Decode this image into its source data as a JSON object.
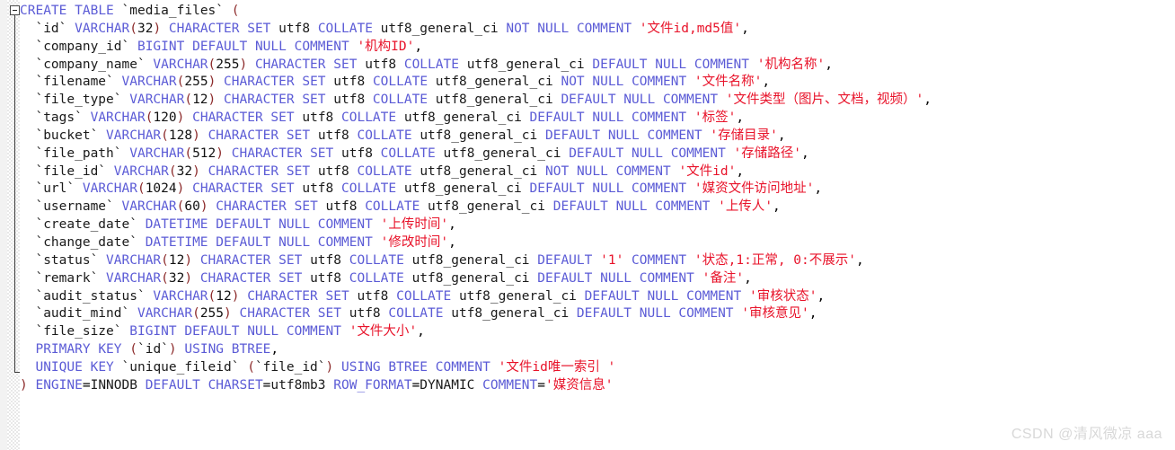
{
  "editor": {
    "language": "sql",
    "fold_widget": "minus-fold-icon",
    "colors": {
      "background": "#ffffff",
      "keyword": "#5b5bd6",
      "type": "#5b5bd6",
      "identifier": "#1a1a1a",
      "string": "#e8132a",
      "paren": "#8c2a2a",
      "gutter": "#f2f2f2",
      "fold_line": "#3a3a3a",
      "watermark": "#d8d8d8"
    }
  },
  "watermark": {
    "text": "CSDN @清风微凉 aaa"
  },
  "sql": {
    "table_name": "media_files",
    "statement": "CREATE TABLE",
    "engine_clause": "ENGINE=INNODB DEFAULT CHARSET=utf8mb3 ROW_FORMAT=DYNAMIC COMMENT='媒资信息'",
    "table_comment": "媒资信息",
    "charset": "utf8mb3",
    "engine": "INNODB",
    "row_format": "DYNAMIC",
    "lines": [
      "CREATE TABLE `media_files` (",
      "  `id` VARCHAR(32) CHARACTER SET utf8 COLLATE utf8_general_ci NOT NULL COMMENT '文件id,md5值',",
      "  `company_id` BIGINT DEFAULT NULL COMMENT '机构ID',",
      "  `company_name` VARCHAR(255) CHARACTER SET utf8 COLLATE utf8_general_ci DEFAULT NULL COMMENT '机构名称',",
      "  `filename` VARCHAR(255) CHARACTER SET utf8 COLLATE utf8_general_ci NOT NULL COMMENT '文件名称',",
      "  `file_type` VARCHAR(12) CHARACTER SET utf8 COLLATE utf8_general_ci DEFAULT NULL COMMENT '文件类型（图片、文档，视频）',",
      "  `tags` VARCHAR(120) CHARACTER SET utf8 COLLATE utf8_general_ci DEFAULT NULL COMMENT '标签',",
      "  `bucket` VARCHAR(128) CHARACTER SET utf8 COLLATE utf8_general_ci DEFAULT NULL COMMENT '存储目录',",
      "  `file_path` VARCHAR(512) CHARACTER SET utf8 COLLATE utf8_general_ci DEFAULT NULL COMMENT '存储路径',",
      "  `file_id` VARCHAR(32) CHARACTER SET utf8 COLLATE utf8_general_ci NOT NULL COMMENT '文件id',",
      "  `url` VARCHAR(1024) CHARACTER SET utf8 COLLATE utf8_general_ci DEFAULT NULL COMMENT '媒资文件访问地址',",
      "  `username` VARCHAR(60) CHARACTER SET utf8 COLLATE utf8_general_ci DEFAULT NULL COMMENT '上传人',",
      "  `create_date` DATETIME DEFAULT NULL COMMENT '上传时间',",
      "  `change_date` DATETIME DEFAULT NULL COMMENT '修改时间',",
      "  `status` VARCHAR(12) CHARACTER SET utf8 COLLATE utf8_general_ci DEFAULT '1' COMMENT '状态,1:正常, 0:不展示',",
      "  `remark` VARCHAR(32) CHARACTER SET utf8 COLLATE utf8_general_ci DEFAULT NULL COMMENT '备注',",
      "  `audit_status` VARCHAR(12) CHARACTER SET utf8 COLLATE utf8_general_ci DEFAULT NULL COMMENT '审核状态',",
      "  `audit_mind` VARCHAR(255) CHARACTER SET utf8 COLLATE utf8_general_ci DEFAULT NULL COMMENT '审核意见',",
      "  `file_size` BIGINT DEFAULT NULL COMMENT '文件大小',",
      "  PRIMARY KEY (`id`) USING BTREE,",
      "  UNIQUE KEY `unique_fileid` (`file_id`) USING BTREE COMMENT '文件id唯一索引 '",
      ") ENGINE=INNODB DEFAULT CHARSET=utf8mb3 ROW_FORMAT=DYNAMIC COMMENT='媒资信息'"
    ],
    "columns": [
      {
        "name": "id",
        "type": "VARCHAR(32)",
        "charset": "utf8",
        "collate": "utf8_general_ci",
        "nullability": "NOT NULL",
        "default": null,
        "comment": "文件id,md5值"
      },
      {
        "name": "company_id",
        "type": "BIGINT",
        "charset": null,
        "collate": null,
        "nullability": "DEFAULT NULL",
        "default": "NULL",
        "comment": "机构ID"
      },
      {
        "name": "company_name",
        "type": "VARCHAR(255)",
        "charset": "utf8",
        "collate": "utf8_general_ci",
        "nullability": "DEFAULT NULL",
        "default": "NULL",
        "comment": "机构名称"
      },
      {
        "name": "filename",
        "type": "VARCHAR(255)",
        "charset": "utf8",
        "collate": "utf8_general_ci",
        "nullability": "NOT NULL",
        "default": null,
        "comment": "文件名称"
      },
      {
        "name": "file_type",
        "type": "VARCHAR(12)",
        "charset": "utf8",
        "collate": "utf8_general_ci",
        "nullability": "DEFAULT NULL",
        "default": "NULL",
        "comment": "文件类型（图片、文档，视频）"
      },
      {
        "name": "tags",
        "type": "VARCHAR(120)",
        "charset": "utf8",
        "collate": "utf8_general_ci",
        "nullability": "DEFAULT NULL",
        "default": "NULL",
        "comment": "标签"
      },
      {
        "name": "bucket",
        "type": "VARCHAR(128)",
        "charset": "utf8",
        "collate": "utf8_general_ci",
        "nullability": "DEFAULT NULL",
        "default": "NULL",
        "comment": "存储目录"
      },
      {
        "name": "file_path",
        "type": "VARCHAR(512)",
        "charset": "utf8",
        "collate": "utf8_general_ci",
        "nullability": "DEFAULT NULL",
        "default": "NULL",
        "comment": "存储路径"
      },
      {
        "name": "file_id",
        "type": "VARCHAR(32)",
        "charset": "utf8",
        "collate": "utf8_general_ci",
        "nullability": "NOT NULL",
        "default": null,
        "comment": "文件id"
      },
      {
        "name": "url",
        "type": "VARCHAR(1024)",
        "charset": "utf8",
        "collate": "utf8_general_ci",
        "nullability": "DEFAULT NULL",
        "default": "NULL",
        "comment": "媒资文件访问地址"
      },
      {
        "name": "username",
        "type": "VARCHAR(60)",
        "charset": "utf8",
        "collate": "utf8_general_ci",
        "nullability": "DEFAULT NULL",
        "default": "NULL",
        "comment": "上传人"
      },
      {
        "name": "create_date",
        "type": "DATETIME",
        "charset": null,
        "collate": null,
        "nullability": "DEFAULT NULL",
        "default": "NULL",
        "comment": "上传时间"
      },
      {
        "name": "change_date",
        "type": "DATETIME",
        "charset": null,
        "collate": null,
        "nullability": "DEFAULT NULL",
        "default": "NULL",
        "comment": "修改时间"
      },
      {
        "name": "status",
        "type": "VARCHAR(12)",
        "charset": "utf8",
        "collate": "utf8_general_ci",
        "nullability": "DEFAULT",
        "default": "'1'",
        "comment": "状态,1:正常, 0:不展示"
      },
      {
        "name": "remark",
        "type": "VARCHAR(32)",
        "charset": "utf8",
        "collate": "utf8_general_ci",
        "nullability": "DEFAULT NULL",
        "default": "NULL",
        "comment": "备注"
      },
      {
        "name": "audit_status",
        "type": "VARCHAR(12)",
        "charset": "utf8",
        "collate": "utf8_general_ci",
        "nullability": "DEFAULT NULL",
        "default": "NULL",
        "comment": "审核状态"
      },
      {
        "name": "audit_mind",
        "type": "VARCHAR(255)",
        "charset": "utf8",
        "collate": "utf8_general_ci",
        "nullability": "DEFAULT NULL",
        "default": "NULL",
        "comment": "审核意见"
      },
      {
        "name": "file_size",
        "type": "BIGINT",
        "charset": null,
        "collate": null,
        "nullability": "DEFAULT NULL",
        "default": "NULL",
        "comment": "文件大小"
      }
    ],
    "keys": [
      {
        "kind": "PRIMARY KEY",
        "name": null,
        "columns": [
          "id"
        ],
        "using": "BTREE",
        "comment": null
      },
      {
        "kind": "UNIQUE KEY",
        "name": "unique_fileid",
        "columns": [
          "file_id"
        ],
        "using": "BTREE",
        "comment": "文件id唯一索引 "
      }
    ]
  }
}
